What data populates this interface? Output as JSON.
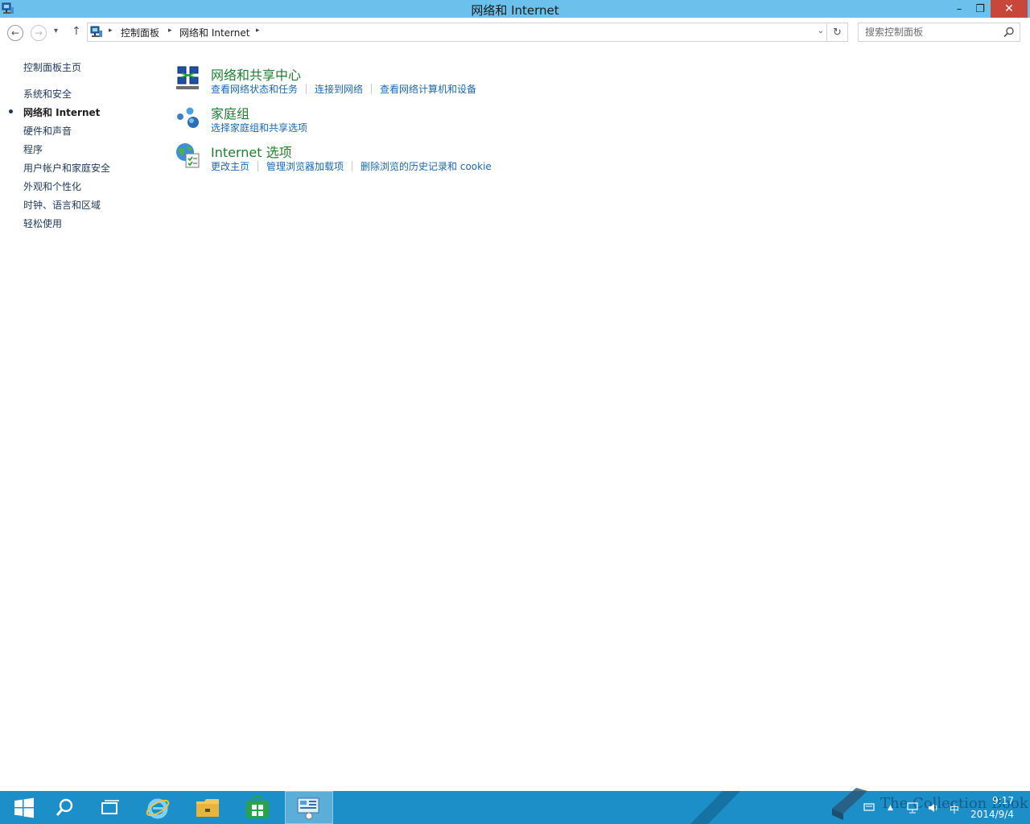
{
  "window": {
    "title": "网络和 Internet",
    "minimize": "–",
    "restore": "❐",
    "close": "✕"
  },
  "nav": {
    "back_icon": "←",
    "forward_icon": "→",
    "recent_icon": "▾",
    "up_icon": "↑",
    "refresh_icon": "↻"
  },
  "address": {
    "crumbs": [
      "控制面板",
      "网络和 Internet"
    ],
    "separator": "▸",
    "dropdown": "⌄"
  },
  "search": {
    "placeholder": "搜索控制面板"
  },
  "sidebar": {
    "home": "控制面板主页",
    "items": [
      {
        "label": "系统和安全"
      },
      {
        "label": "网络和 Internet",
        "current": true
      },
      {
        "label": "硬件和声音"
      },
      {
        "label": "程序"
      },
      {
        "label": "用户帐户和家庭安全"
      },
      {
        "label": "外观和个性化"
      },
      {
        "label": "时钟、语言和区域"
      },
      {
        "label": "轻松使用"
      }
    ]
  },
  "categories": [
    {
      "title": "网络和共享中心",
      "icon": "network-sharing-center-icon",
      "links": [
        "查看网络状态和任务",
        "连接到网络",
        "查看网络计算机和设备"
      ]
    },
    {
      "title": "家庭组",
      "icon": "homegroup-icon",
      "links": [
        "选择家庭组和共享选项"
      ]
    },
    {
      "title": "Internet 选项",
      "icon": "internet-options-icon",
      "links": [
        "更改主页",
        "管理浏览器加载项",
        "删除浏览的历史记录和 cookie"
      ]
    }
  ],
  "taskbar": {
    "watermark": "The Collection Book",
    "time": "9:17",
    "date": "2014/9/4",
    "ime": "中",
    "tray_expand": "▲"
  },
  "colors": {
    "titlebar": "#6bc1ec",
    "close": "#c7473b",
    "category_title": "#1f7d33",
    "link": "#1a68b0",
    "taskbar": "#1c8fc8"
  }
}
